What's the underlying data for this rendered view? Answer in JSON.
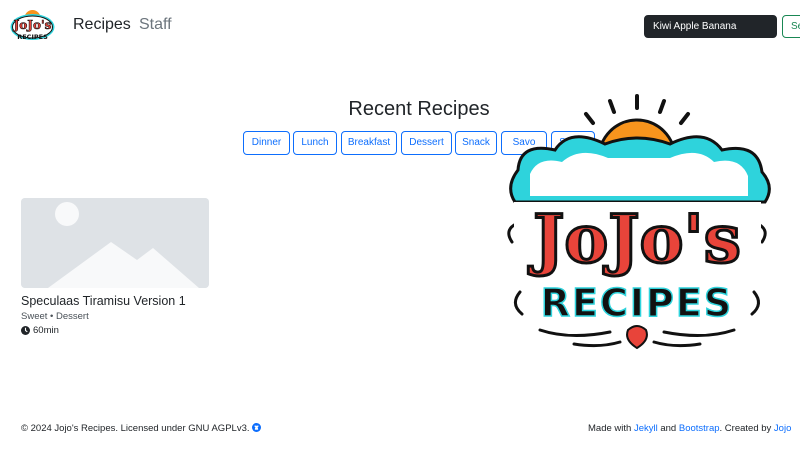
{
  "navbar": {
    "logo_text_top": "JoJo's",
    "logo_text_bottom": "RECIPES",
    "links": [
      {
        "label": "Recipes"
      },
      {
        "label": "Staff"
      }
    ],
    "search": {
      "value": "Kiwi Apple Banana"
    },
    "search_button_label": "Se"
  },
  "main": {
    "title": "Recent Recipes",
    "tags": [
      "Dinner",
      "Lunch",
      "Breakfast",
      "Dessert",
      "Snack",
      "Savo",
      "Sweet"
    ]
  },
  "cards": [
    {
      "title": "Speculaas Tiramisu Version 1",
      "meta": "Sweet • Dessert",
      "time": "60min"
    }
  ],
  "big_logo": {
    "text_top": "JoJo's",
    "text_bottom": "RECIPES"
  },
  "footer": {
    "left": "© 2024 Jojo's Recipes. Licensed under GNU AGPLv3.",
    "made_with": "Made with",
    "jekyll": "Jekyll",
    "and": "and",
    "bootstrap": "Bootstrap",
    "created_by": ". Created by",
    "author": "Jojo"
  },
  "colors": {
    "primary": "#0d6efd",
    "success": "#198754",
    "dark": "#212529",
    "logo_red": "#e8443a",
    "logo_orange": "#f7941d",
    "logo_cyan": "#2ed3dc"
  }
}
